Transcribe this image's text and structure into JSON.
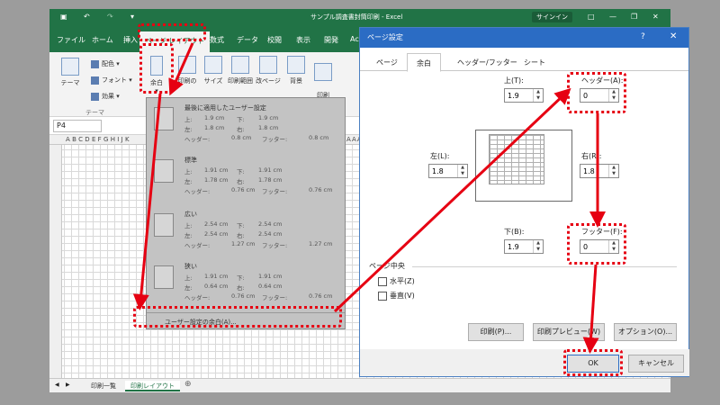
{
  "excel": {
    "title": "サンプル調査書封筒印刷 - Excel",
    "signin": "サインイン",
    "tabs": [
      "ファイル",
      "ホーム",
      "挿入",
      "ページ レイアウト",
      "数式",
      "データ",
      "校閲",
      "表示",
      "開発",
      "Ac"
    ],
    "ribbon": {
      "theme": "テーマ",
      "colors": "配色",
      "fonts": "フォント",
      "effects": "効果",
      "margins": "余白",
      "orientation": "印刷の",
      "size": "サイズ",
      "print_area": "印刷範囲",
      "breaks": "改ページ",
      "background": "背景",
      "print_titles": "印刷\nタイトル",
      "theme_group": "テーマ"
    },
    "name_box": "P4",
    "column_headers": "ABCDEFGHIJK",
    "column_headers_right": "AAAAA",
    "sheet_tabs": [
      "印刷一覧",
      "印刷レイアウト"
    ]
  },
  "margins_menu": {
    "options": [
      {
        "title": "最後に適用したユーザー設定",
        "top": "1.9 cm",
        "bottom": "1.9 cm",
        "left": "1.8 cm",
        "right": "1.8 cm",
        "header": "0.8 cm",
        "footer": "0.8 cm"
      },
      {
        "title": "標準",
        "top": "1.91 cm",
        "bottom": "1.91 cm",
        "left": "1.78 cm",
        "right": "1.78 cm",
        "header": "0.76 cm",
        "footer": "0.76 cm"
      },
      {
        "title": "広い",
        "top": "2.54 cm",
        "bottom": "2.54 cm",
        "left": "2.54 cm",
        "right": "2.54 cm",
        "header": "1.27 cm",
        "footer": "1.27 cm"
      },
      {
        "title": "狭い",
        "top": "1.91 cm",
        "bottom": "1.91 cm",
        "left": "0.64 cm",
        "right": "0.64 cm",
        "header": "0.76 cm",
        "footer": "0.76 cm"
      }
    ],
    "labels": {
      "top": "上:",
      "bottom": "下:",
      "left": "左:",
      "right": "右:",
      "header": "ヘッダー:",
      "footer": "フッター:"
    },
    "custom": "ユーザー設定の余白(A)..."
  },
  "dialog": {
    "title": "ページ設定",
    "help": "?",
    "close": "✕",
    "tabs": [
      "ページ",
      "余白",
      "ヘッダー/フッター",
      "シート"
    ],
    "top_label": "上(T):",
    "top_value": "1.9",
    "header_label": "ヘッダー(A):",
    "header_value": "0",
    "left_label": "左(L):",
    "left_value": "1.8",
    "right_label": "右(R):",
    "right_value": "1.8",
    "bottom_label": "下(B):",
    "bottom_value": "1.9",
    "footer_label": "フッター(F):",
    "footer_value": "0",
    "center_group": "ページ中央",
    "horizontal": "水平(Z)",
    "vertical": "垂直(V)",
    "print_btn": "印刷(P)...",
    "preview_btn": "印刷プレビュー(W)",
    "options_btn": "オプション(O)...",
    "ok_btn": "OK",
    "cancel_btn": "キャンセル"
  },
  "colors": {
    "excel_green": "#217346",
    "dialog_blue": "#2b6cc4",
    "annotation_red": "#e60012"
  }
}
